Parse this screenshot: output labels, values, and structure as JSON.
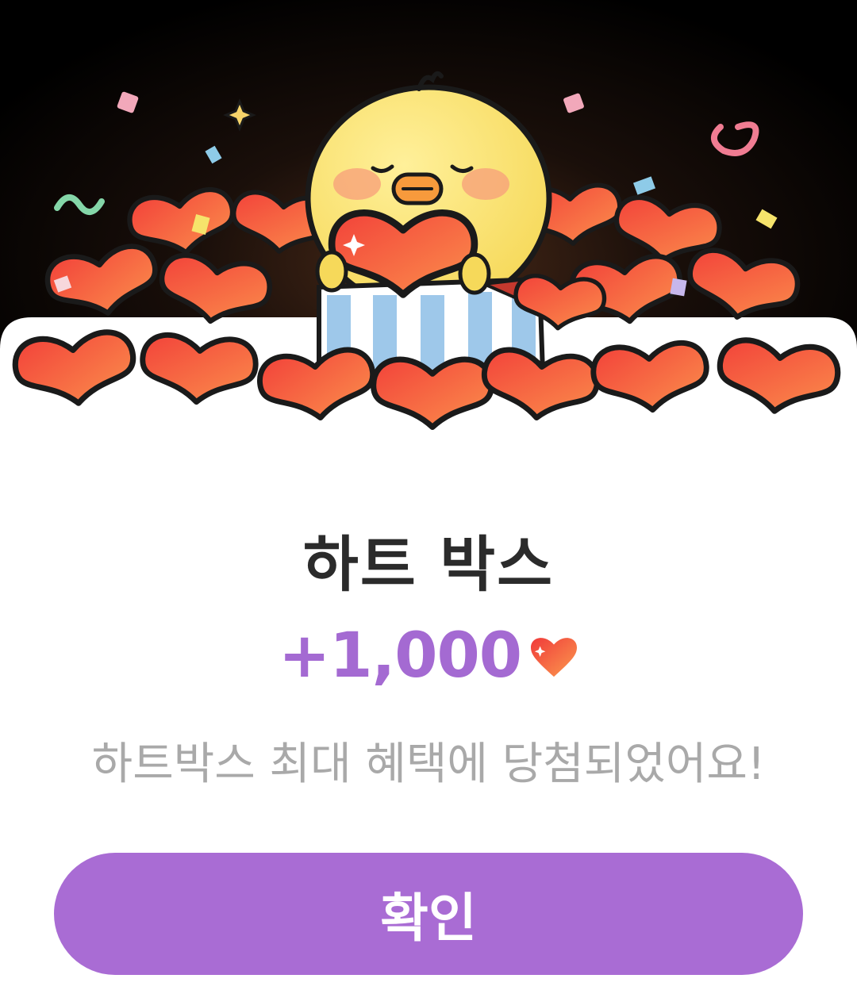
{
  "dialog": {
    "title": "하트 박스",
    "reward": {
      "amount": "+1,000",
      "icon": "heart-icon"
    },
    "message": "하트박스 최대 혜택에 당첨되었어요!",
    "confirm_label": "확인"
  },
  "colors": {
    "accent": "#a96cd4",
    "reward_text": "#a46ad2",
    "message_text": "#a9a9a9",
    "title_text": "#2b2b2b",
    "hero_background": "#000000",
    "heart": "#f35a3a"
  },
  "illustration": {
    "icons": [
      "chick-character",
      "heart-pile",
      "gift-box-icon",
      "confetti",
      "sparkle-icon"
    ]
  }
}
